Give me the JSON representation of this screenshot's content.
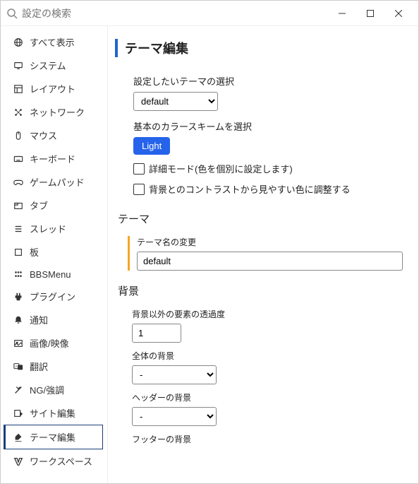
{
  "search": {
    "placeholder": "設定の検索"
  },
  "sidebar": {
    "items": [
      {
        "label": "すべて表示",
        "icon": "globe-icon"
      },
      {
        "label": "システム",
        "icon": "monitor-icon"
      },
      {
        "label": "レイアウト",
        "icon": "layout-icon"
      },
      {
        "label": "ネットワーク",
        "icon": "network-icon"
      },
      {
        "label": "マウス",
        "icon": "mouse-icon"
      },
      {
        "label": "キーボード",
        "icon": "keyboard-icon"
      },
      {
        "label": "ゲームパッド",
        "icon": "gamepad-icon"
      },
      {
        "label": "タブ",
        "icon": "tab-icon"
      },
      {
        "label": "スレッド",
        "icon": "thread-icon"
      },
      {
        "label": "板",
        "icon": "board-icon"
      },
      {
        "label": "BBSMenu",
        "icon": "bbsmenu-icon"
      },
      {
        "label": "プラグイン",
        "icon": "plugin-icon"
      },
      {
        "label": "通知",
        "icon": "bell-icon"
      },
      {
        "label": "画像/映像",
        "icon": "image-icon"
      },
      {
        "label": "翻訳",
        "icon": "translate-icon"
      },
      {
        "label": "NG/強調",
        "icon": "ng-icon"
      },
      {
        "label": "サイト編集",
        "icon": "site-edit-icon"
      },
      {
        "label": "テーマ編集",
        "icon": "theme-edit-icon"
      },
      {
        "label": "ワークスペース",
        "icon": "workspace-icon"
      }
    ],
    "active_index": 17
  },
  "main": {
    "title": "テーマ編集",
    "theme_select_label": "設定したいテーマの選択",
    "theme_select_value": "default",
    "color_scheme_label": "基本のカラースキームを選択",
    "color_scheme_button": "Light",
    "checkbox_detailed": "詳細モード(色を個別に設定します)",
    "checkbox_contrast": "背景とのコントラストから見やすい色に調整する",
    "theme_section_title": "テーマ",
    "theme_name_label": "テーマ名の変更",
    "theme_name_value": "default",
    "bg_section_title": "背景",
    "opacity_label": "背景以外の要素の透過度",
    "opacity_value": "1",
    "overall_bg_label": "全体の背景",
    "overall_bg_value": "-",
    "header_bg_label": "ヘッダーの背景",
    "header_bg_value": "-",
    "footer_bg_label": "フッターの背景"
  }
}
